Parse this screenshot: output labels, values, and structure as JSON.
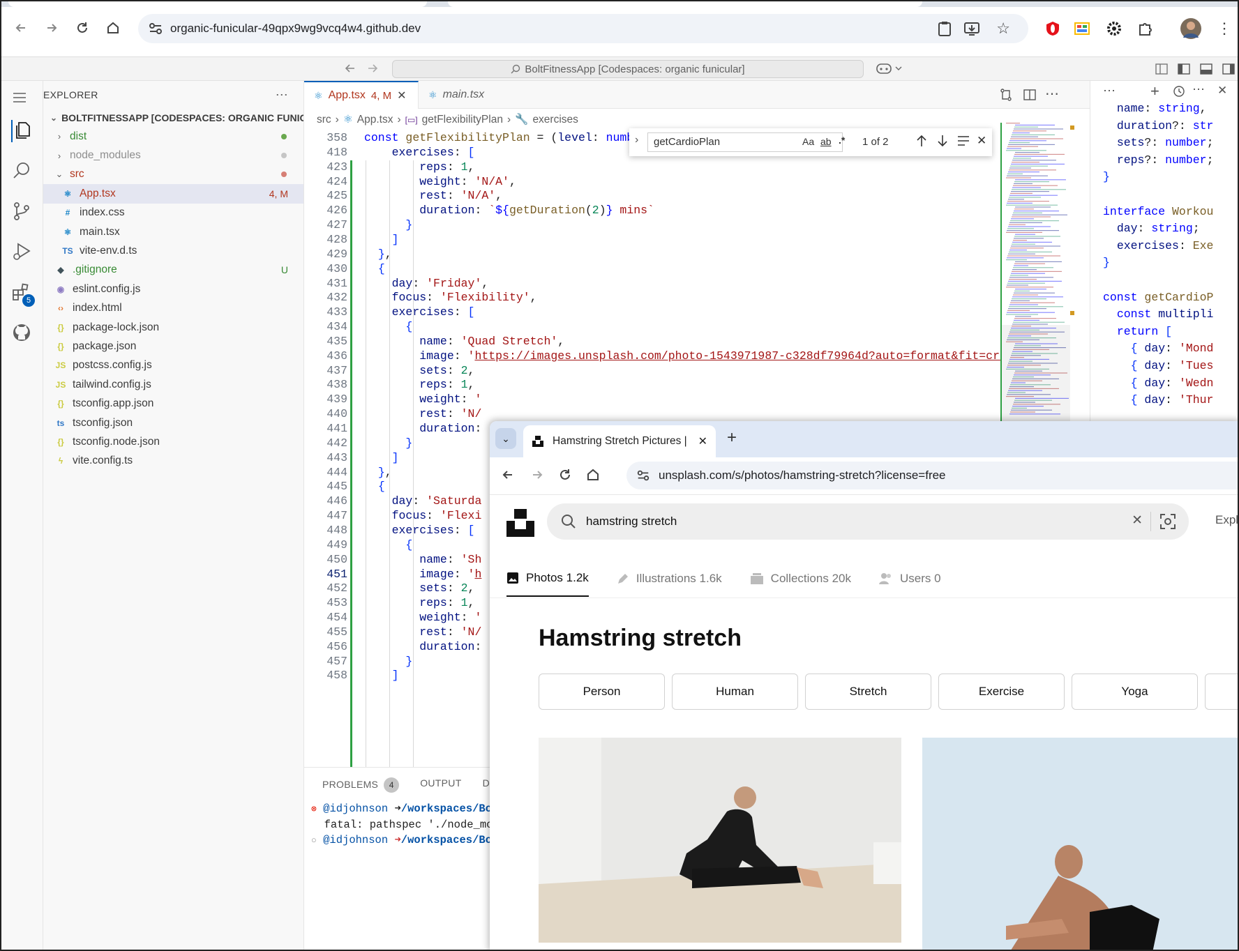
{
  "browser": {
    "url": "organic-funicular-49qpx9wg9vcq4w4.github.dev"
  },
  "vscode": {
    "command_center": "BoltFitnessApp [Codespaces: organic funicular]",
    "activity_badge": "5",
    "explorer": {
      "header": "EXPLORER",
      "root": "BOLTFITNESSAPP [CODESPACES: ORGANIC FUNICU...",
      "items": [
        {
          "label": "dist",
          "kind": "folder",
          "indent": 1,
          "color": "#388a34",
          "dot": "#6aa84f"
        },
        {
          "label": "node_modules",
          "kind": "folder",
          "indent": 1,
          "color": "#8e8e8e",
          "dot": "#c6c6c6"
        },
        {
          "label": "src",
          "kind": "folder-open",
          "indent": 1,
          "color": "#b1361e",
          "dot": "#d67f75"
        },
        {
          "label": "App.tsx",
          "kind": "react",
          "indent": 2,
          "color": "#b1361e",
          "decoration": "4, M",
          "selected": true
        },
        {
          "label": "index.css",
          "kind": "css",
          "indent": 2,
          "color": "#3b3b3b"
        },
        {
          "label": "main.tsx",
          "kind": "react",
          "indent": 2,
          "color": "#3b3b3b"
        },
        {
          "label": "vite-env.d.ts",
          "kind": "ts",
          "indent": 2,
          "color": "#3b3b3b"
        },
        {
          "label": ".gitignore",
          "kind": "git",
          "indent": 1,
          "color": "#388a34",
          "decoration": "U"
        },
        {
          "label": "eslint.config.js",
          "kind": "eslint",
          "indent": 1,
          "color": "#3b3b3b"
        },
        {
          "label": "index.html",
          "kind": "html",
          "indent": 1,
          "color": "#3b3b3b"
        },
        {
          "label": "package-lock.json",
          "kind": "json",
          "indent": 1,
          "color": "#3b3b3b"
        },
        {
          "label": "package.json",
          "kind": "json",
          "indent": 1,
          "color": "#3b3b3b"
        },
        {
          "label": "postcss.config.js",
          "kind": "js",
          "indent": 1,
          "color": "#3b3b3b"
        },
        {
          "label": "tailwind.config.js",
          "kind": "js",
          "indent": 1,
          "color": "#3b3b3b"
        },
        {
          "label": "tsconfig.app.json",
          "kind": "json",
          "indent": 1,
          "color": "#3b3b3b"
        },
        {
          "label": "tsconfig.json",
          "kind": "tsconfig",
          "indent": 1,
          "color": "#3b3b3b"
        },
        {
          "label": "tsconfig.node.json",
          "kind": "json",
          "indent": 1,
          "color": "#3b3b3b"
        },
        {
          "label": "vite.config.ts",
          "kind": "vite",
          "indent": 1,
          "color": "#3b3b3b"
        }
      ]
    },
    "tabs": [
      {
        "label": "App.tsx",
        "status": "4, M",
        "active": true
      },
      {
        "label": "main.tsx",
        "status": "",
        "active": false
      }
    ],
    "breadcrumb": [
      "src",
      "App.tsx",
      "getFlexibilityPlan",
      "exercises"
    ],
    "find": {
      "query": "getCardioPlan",
      "result": "1 of 2",
      "opt_case": "Aa",
      "opt_word": "ab",
      "opt_regex": ".*"
    },
    "code_lines": [
      {
        "n": "358",
        "html": "<span class='k'>const</span> <span class='f'>getFlexibilityPlan</span> = (<span class='p'>level</span>: <span class='k'>numbe</span>"
      },
      {
        "n": "418",
        "html": "    <span class='p'>exercises</span>: <span class='br'>[</span>"
      },
      {
        "n": "423",
        "html": "        <span class='p'>reps</span>: <span class='n'>1</span>,"
      },
      {
        "n": "424",
        "html": "        <span class='p'>weight</span>: <span class='s'>'N/A'</span>,"
      },
      {
        "n": "425",
        "html": "        <span class='p'>rest</span>: <span class='s'>'N/A'</span>,"
      },
      {
        "n": "426",
        "html": "        <span class='p'>duration</span>: <span class='s'>`</span><span class='k'>${</span><span class='f'>getDuration</span>(<span class='n'>2</span>)<span class='k'>}</span><span class='s'> mins`</span>"
      },
      {
        "n": "427",
        "html": "      <span class='br'>}</span>"
      },
      {
        "n": "428",
        "html": "    <span class='br'>]</span>"
      },
      {
        "n": "429",
        "html": "  <span class='br'>}</span>,"
      },
      {
        "n": "430",
        "html": "  <span class='br'>{</span>"
      },
      {
        "n": "431",
        "html": "    <span class='p'>day</span>: <span class='s'>'Friday'</span>,"
      },
      {
        "n": "432",
        "html": "    <span class='p'>focus</span>: <span class='s'>'Flexibility'</span>,"
      },
      {
        "n": "433",
        "html": "    <span class='p'>exercises</span>: <span class='br'>[</span>"
      },
      {
        "n": "434",
        "html": "      <span class='br'>{</span>"
      },
      {
        "n": "435",
        "html": "        <span class='p'>name</span>: <span class='s'>'Quad Stretch'</span>,"
      },
      {
        "n": "436",
        "html": "        <span class='p'>image</span>: <span class='s'>'</span><span class='u'>https://images.unsplash.com/photo-1543971987-c328df79964d?auto=format&amp;fit=crop</span>"
      },
      {
        "n": "437",
        "html": "        <span class='p'>sets</span>: <span class='n'>2</span>,"
      },
      {
        "n": "438",
        "html": "        <span class='p'>reps</span>: <span class='n'>1</span>,"
      },
      {
        "n": "439",
        "html": "        <span class='p'>weight</span>: <span class='s'>'</span>"
      },
      {
        "n": "440",
        "html": "        <span class='p'>rest</span>: <span class='s'>'N/</span>"
      },
      {
        "n": "441",
        "html": "        <span class='p'>duration</span>:"
      },
      {
        "n": "442",
        "html": "      <span class='br'>}</span>"
      },
      {
        "n": "443",
        "html": "    <span class='br'>]</span>"
      },
      {
        "n": "444",
        "html": "  <span class='br'>}</span>,"
      },
      {
        "n": "445",
        "html": "  <span class='br'>{</span>"
      },
      {
        "n": "446",
        "html": "    <span class='p'>day</span>: <span class='s'>'Saturda</span>"
      },
      {
        "n": "447",
        "html": "    <span class='p'>focus</span>: <span class='s'>'Flexi</span>"
      },
      {
        "n": "448",
        "html": "    <span class='p'>exercises</span>: <span class='br'>[</span>"
      },
      {
        "n": "449",
        "html": "      <span class='br'>{</span>"
      },
      {
        "n": "450",
        "html": "        <span class='p'>name</span>: <span class='s'>'Sh</span>"
      },
      {
        "n": "451",
        "html": "        <span class='p'>image</span>: <span class='s'>'</span><span class='u'>h</span>"
      },
      {
        "n": "452",
        "html": "        <span class='p'>sets</span>: <span class='n'>2</span>,"
      },
      {
        "n": "453",
        "html": "        <span class='p'>reps</span>: <span class='n'>1</span>,"
      },
      {
        "n": "454",
        "html": "        <span class='p'>weight</span>: <span class='s'>'</span>"
      },
      {
        "n": "455",
        "html": "        <span class='p'>rest</span>: <span class='s'>'N/</span>"
      },
      {
        "n": "456",
        "html": "        <span class='p'>duration</span>:"
      },
      {
        "n": "457",
        "html": "      <span class='br'>}</span>"
      },
      {
        "n": "458",
        "html": "    <span class='br'>]</span>"
      }
    ],
    "secondary_code": "<span class='p'>name</span>: <span class='k'>string</span>,\n  <span class='p'>duration</span>?: <span class='k'>str</span>\n  <span class='p'>sets</span>?: <span class='k'>number</span>;\n  <span class='p'>reps</span>?: <span class='k'>number</span>;\n<span class='br'>}</span>\n\n<span class='k'>interface</span> <span class='f'>Workou</span>\n  <span class='p'>day</span>: <span class='k'>string</span>;\n  <span class='p'>exercises</span>: <span class='f'>Exe</span>\n<span class='br'>}</span>\n\n<span class='k'>const</span> <span class='f'>getCardioP</span>\n  <span class='k'>const</span> <span class='p'>multipli</span>\n  <span class='k'>return</span> <span class='br'>[</span>\n    <span class='br'>{</span> <span class='p'>day</span>: <span class='s'>'Mond</span>\n    <span class='br'>{</span> <span class='p'>day</span>: <span class='s'>'Tues</span>\n    <span class='br'>{</span> <span class='p'>day</span>: <span class='s'>'Wedn</span>\n    <span class='br'>{</span> <span class='p'>day</span>: <span class='s'>'Thur</span>",
    "panel": {
      "tabs": [
        "PROBLEMS",
        "OUTPUT",
        "DEBU"
      ],
      "problems_count": "4",
      "terminal": [
        {
          "icon": "⊗",
          "user": "@idjohnson",
          "arrow": "➜",
          "path": "/workspaces/Bo"
        },
        {
          "icon": "",
          "text": "fatal: pathspec './node_mod"
        },
        {
          "icon": "○",
          "user": "@idjohnson",
          "arrow": "➜",
          "path": "/workspaces/Bo"
        }
      ]
    }
  },
  "browser2": {
    "tab_title": "Hamstring Stretch Pictures | Do",
    "url": "unsplash.com/s/photos/hamstring-stretch?license=free",
    "search_value": "hamstring stretch",
    "explore": "Expl",
    "tabs": [
      {
        "label": "Photos",
        "count": "1.2k"
      },
      {
        "label": "Illustrations",
        "count": "1.6k"
      },
      {
        "label": "Collections",
        "count": "20k"
      },
      {
        "label": "Users",
        "count": "0"
      }
    ],
    "title": "Hamstring stretch",
    "chips": [
      "Person",
      "Human",
      "Stretch",
      "Exercise",
      "Yoga"
    ]
  }
}
